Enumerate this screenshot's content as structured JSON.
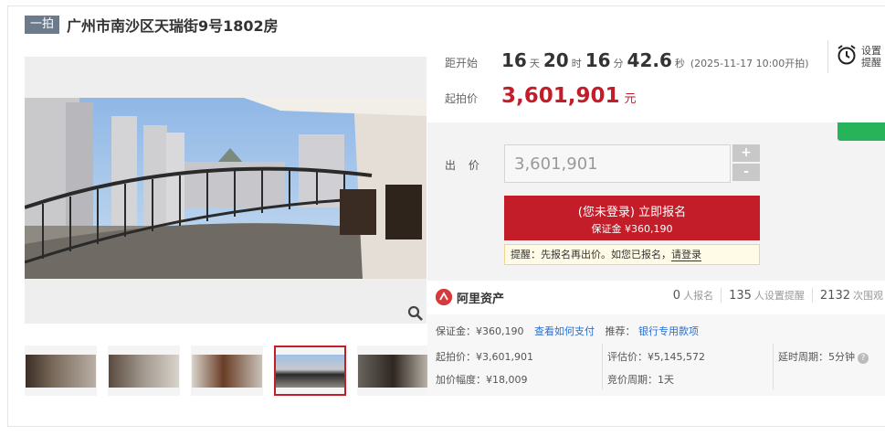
{
  "header": {
    "tag": "一拍",
    "title": "广州市南沙区天瑞街9号1802房"
  },
  "countdown": {
    "label": "距开始",
    "days": "16",
    "days_unit": "天",
    "hours": "20",
    "hours_unit": "时",
    "minutes": "16",
    "minutes_unit": "分",
    "seconds": "42.6",
    "seconds_unit": "秒",
    "start_time": "(2025-11-17 10:00开拍)"
  },
  "remind": {
    "label_line1": "设置",
    "label_line2": "提醒",
    "icon": "alarm-clock-icon"
  },
  "start_price": {
    "label": "起拍价",
    "value": "3,601,901",
    "unit": "元"
  },
  "bid": {
    "label": "出 价",
    "value": "3,601,901",
    "plus": "+",
    "minus": "-",
    "signup_main": "(您未登录) 立即报名",
    "signup_sub": "保证金 ¥360,190",
    "hint_prefix": "提醒：先报名再出价。如您已报名，",
    "hint_link": "请登录"
  },
  "platform": {
    "name": "阿里资产",
    "signed_count": "0",
    "signed_label": "人报名",
    "remind_count": "135",
    "remind_label": "人设置提醒",
    "views_count": "2132",
    "views_label": "次围观"
  },
  "info": {
    "deposit": "保证金：¥360,190",
    "deposit_link": "查看如何支付",
    "recommend_label": "推荐：",
    "recommend_link": "银行专用款项",
    "start_price": "起拍价：¥3,601,901",
    "increment": "加价幅度：¥18,009",
    "appraisal": "评估价：¥5,145,572",
    "cycle": "竞价周期：1天",
    "delay": "延时周期：5分钟"
  },
  "colors": {
    "accent": "#c41d2a",
    "link": "#2a6ecf",
    "green": "#27b35a"
  }
}
